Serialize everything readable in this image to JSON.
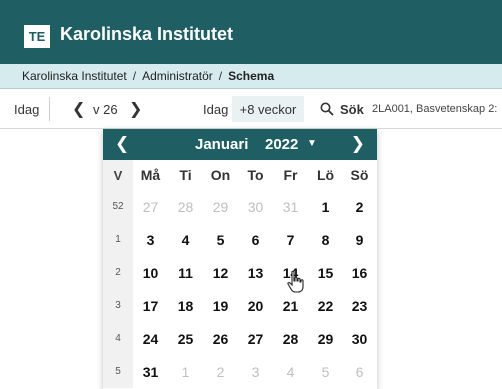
{
  "app": {
    "logo": "TE",
    "title": "Karolinska Institutet"
  },
  "breadcrumb": {
    "items": [
      "Karolinska Institutet",
      "Administratör"
    ],
    "current": "Schema",
    "separator": "/"
  },
  "toolbar": {
    "today_left": "Idag",
    "week": "v 26",
    "today_right": "Idag",
    "plus_weeks": "+8 veckor",
    "search_label": "Sök",
    "search_value": "2LA001, Basvetenskap 2:"
  },
  "calendar": {
    "month": "Januari",
    "year": "2022",
    "week_header": "V",
    "weekdays": [
      "Må",
      "Ti",
      "On",
      "To",
      "Fr",
      "Lö",
      "Sö"
    ],
    "weeks": [
      {
        "week": "52",
        "days": [
          {
            "d": "27",
            "muted": true
          },
          {
            "d": "28",
            "muted": true
          },
          {
            "d": "29",
            "muted": true
          },
          {
            "d": "30",
            "muted": true
          },
          {
            "d": "31",
            "muted": true
          },
          {
            "d": "1",
            "muted": false
          },
          {
            "d": "2",
            "muted": false
          }
        ]
      },
      {
        "week": "1",
        "days": [
          {
            "d": "3",
            "muted": false
          },
          {
            "d": "4",
            "muted": false
          },
          {
            "d": "5",
            "muted": false
          },
          {
            "d": "6",
            "muted": false
          },
          {
            "d": "7",
            "muted": false
          },
          {
            "d": "8",
            "muted": false
          },
          {
            "d": "9",
            "muted": false
          }
        ]
      },
      {
        "week": "2",
        "days": [
          {
            "d": "10",
            "muted": false
          },
          {
            "d": "11",
            "muted": false
          },
          {
            "d": "12",
            "muted": false
          },
          {
            "d": "13",
            "muted": false
          },
          {
            "d": "14",
            "muted": false
          },
          {
            "d": "15",
            "muted": false
          },
          {
            "d": "16",
            "muted": false
          }
        ]
      },
      {
        "week": "3",
        "days": [
          {
            "d": "17",
            "muted": false
          },
          {
            "d": "18",
            "muted": false
          },
          {
            "d": "19",
            "muted": false
          },
          {
            "d": "20",
            "muted": false
          },
          {
            "d": "21",
            "muted": false
          },
          {
            "d": "22",
            "muted": false
          },
          {
            "d": "23",
            "muted": false
          }
        ]
      },
      {
        "week": "4",
        "days": [
          {
            "d": "24",
            "muted": false
          },
          {
            "d": "25",
            "muted": false
          },
          {
            "d": "26",
            "muted": false
          },
          {
            "d": "27",
            "muted": false
          },
          {
            "d": "28",
            "muted": false
          },
          {
            "d": "29",
            "muted": false
          },
          {
            "d": "30",
            "muted": false
          }
        ]
      },
      {
        "week": "5",
        "days": [
          {
            "d": "31",
            "muted": false
          },
          {
            "d": "1",
            "muted": true
          },
          {
            "d": "2",
            "muted": true
          },
          {
            "d": "3",
            "muted": true
          },
          {
            "d": "4",
            "muted": true
          },
          {
            "d": "5",
            "muted": true
          },
          {
            "d": "6",
            "muted": true
          }
        ]
      }
    ]
  },
  "colors": {
    "brand": "#1f5f63",
    "breadcrumb_bg": "#d6ebed",
    "muted_day": "#bfbfbf"
  },
  "icons": {
    "prev": "chevron-left-icon",
    "next": "chevron-right-icon",
    "search": "search-icon",
    "dropdown": "caret-down-icon",
    "cursor": "hand-cursor-icon"
  }
}
